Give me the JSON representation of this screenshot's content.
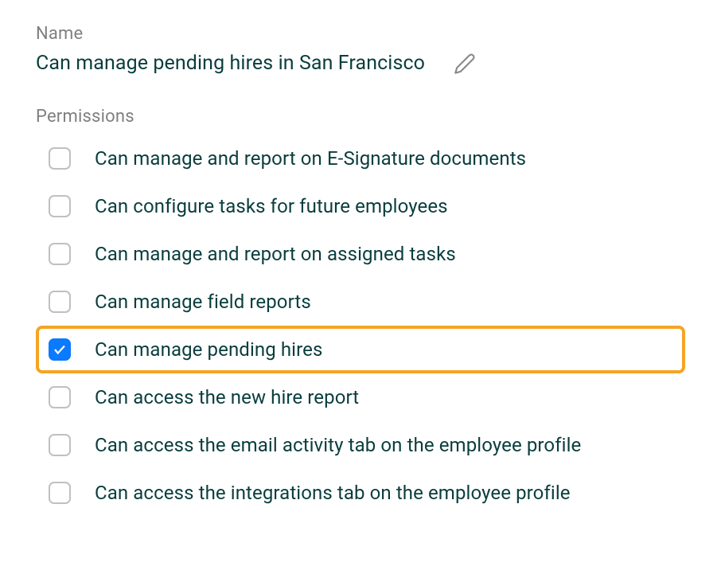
{
  "name": {
    "label": "Name",
    "value": "Can manage pending hires in San Francisco"
  },
  "permissions": {
    "label": "Permissions",
    "items": [
      {
        "label": "Can manage and report on E-Signature documents",
        "checked": false,
        "highlighted": false
      },
      {
        "label": "Can configure tasks for future employees",
        "checked": false,
        "highlighted": false
      },
      {
        "label": "Can manage and report on assigned tasks",
        "checked": false,
        "highlighted": false
      },
      {
        "label": "Can manage field reports",
        "checked": false,
        "highlighted": false
      },
      {
        "label": "Can manage pending hires",
        "checked": true,
        "highlighted": true
      },
      {
        "label": "Can access the new hire report",
        "checked": false,
        "highlighted": false
      },
      {
        "label": "Can access the email activity tab on the employee profile",
        "checked": false,
        "highlighted": false
      },
      {
        "label": "Can access the integrations tab on the employee profile",
        "checked": false,
        "highlighted": false
      }
    ]
  },
  "colors": {
    "highlight_border": "#f5a524",
    "checked_bg": "#0a7aff",
    "text_dark": "#0a3d3d",
    "text_muted": "#808080"
  }
}
